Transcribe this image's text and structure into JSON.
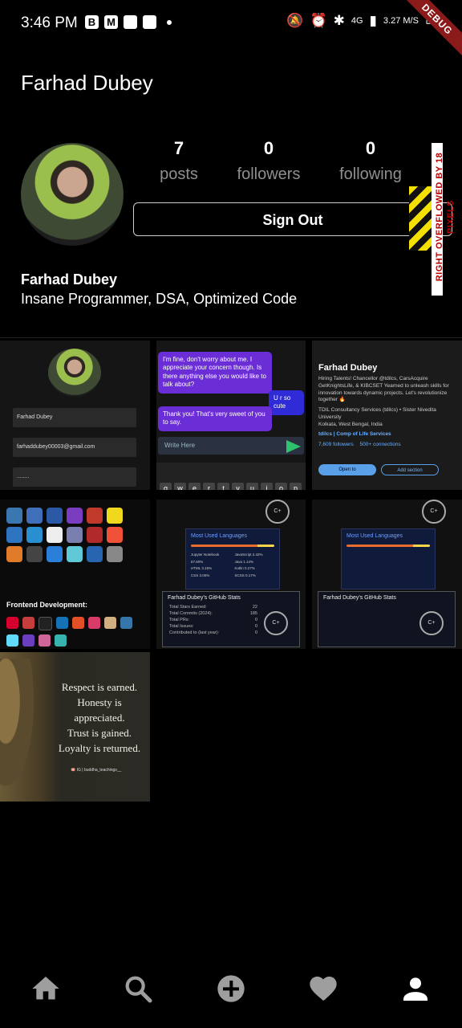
{
  "status_bar": {
    "time": "3:46 PM",
    "notifications": [
      "B",
      "M"
    ],
    "network": "4G",
    "speed": "3.27 M/S",
    "debug_banner": "DEBUG",
    "icons": [
      "mute-icon",
      "alarm-icon",
      "bluetooth-icon",
      "volte-icon",
      "signal-icon",
      "battery-icon"
    ]
  },
  "header": {
    "title": "Farhad Dubey"
  },
  "profile": {
    "posts_count": "7",
    "posts_label": "posts",
    "followers_count": "0",
    "followers_label": "followers",
    "following_count": "0",
    "following_label": "following",
    "sign_out_label": "Sign Out",
    "overflow_warning": "RIGHT OVERFLOWED BY 18 PIXELS",
    "name": "Farhad Dubey",
    "bio": "Insane Programmer, DSA, Optimized Code"
  },
  "posts": [
    {
      "kind": "signup-form",
      "name_value": "Farhad Dubey",
      "email_value": "farhaddubey00003@gmail.com",
      "password_value": "........"
    },
    {
      "kind": "chat",
      "msg1": "I'm fine, don't worry about me. I appreciate your concern though. Is there anything else you would like to talk about?",
      "msg2": "U r so cute",
      "msg3": "Thank you! That's very sweet of you to say.",
      "input_placeholder": "Write Here",
      "keys": [
        "q",
        "w",
        "e",
        "r",
        "t",
        "y",
        "u",
        "i",
        "o",
        "p"
      ]
    },
    {
      "kind": "linkedin-profile",
      "name": "Farhad Dubey",
      "headline": "Hiring   Talents! Chancellor @tdilcs, CarsAcquire  GetKnightsLife, & KIBCSET Yearned to unleash skills for innovation towards dynamic projects. Let's revolutionize together 🔥",
      "company": "TDIL Consultancy Services (tdilcs) • Sister Nivedita University",
      "location": "Kolkata, West Bengal, India",
      "link": "tdilcs | Comp of Life Services",
      "followers": "7,609 followers",
      "connections": "500+ connections",
      "open_to": "Open to",
      "add_section": "Add section"
    },
    {
      "kind": "tech-icons",
      "section_label": "Frontend Development:"
    },
    {
      "kind": "github-stats",
      "lang_title": "Most Used Languages",
      "lang_items": [
        "Jupyter Notebook 67.60%",
        "Java 1.14%",
        "HTML 3.15%",
        "Kotlin 0.27%",
        "CSS 3.05%",
        "SCSS 0.17%",
        "JavaScript 2.42%"
      ],
      "stats_title": "Farhad Dubey's GitHub Stats",
      "stats_lines": [
        "Total Stars Earned:",
        "Total Commits (2024):",
        "Total PRs:",
        "Total Issues:",
        "Contributed to (last year):"
      ],
      "stats_values": [
        "22",
        "185",
        "0",
        "0",
        "0"
      ],
      "rank": "C+"
    },
    {
      "kind": "github-stats",
      "lang_title": "Most Used Languages",
      "stats_title": "Farhad Dubey's GitHub Stats",
      "rank": "C+"
    },
    {
      "kind": "quote",
      "lines": [
        "Respect is earned.",
        "Honesty is",
        "appreciated.",
        "Trust is gained.",
        "Loyalty is returned."
      ],
      "signature": "🪷 IG | buddha_teachings__"
    }
  ],
  "bottom_nav": [
    {
      "icon": "home-icon"
    },
    {
      "icon": "search-icon"
    },
    {
      "icon": "add-post-icon"
    },
    {
      "icon": "heart-icon"
    },
    {
      "icon": "profile-icon"
    }
  ],
  "colors": {
    "background": "#000000",
    "muted_text": "#8f8f8f",
    "chat_bubble": "#6a2dd6",
    "send_green": "#2ec36d"
  }
}
